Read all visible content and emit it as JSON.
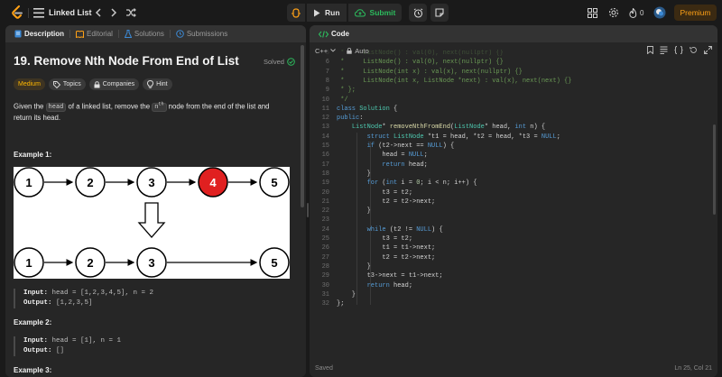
{
  "topbar": {
    "list_title": "Linked List",
    "run_label": "Run",
    "submit_label": "Submit",
    "streak_count": "0",
    "premium_label": "Premium"
  },
  "left": {
    "tabs": [
      "Description",
      "Editorial",
      "Solutions",
      "Submissions"
    ],
    "title": "19. Remove Nth Node From End of List",
    "solved_label": "Solved",
    "tags": [
      "Medium",
      "Topics",
      "Companies",
      "Hint"
    ],
    "desc_1": "Given the ",
    "desc_code_head": "head",
    "desc_2": " of a linked list, remove the ",
    "desc_code_nth": "n",
    "desc_sup": "th",
    "desc_3": " node from the end of the list and return its head.",
    "example1": "Example 1:",
    "example2": "Example 2:",
    "example3": "Example 3:",
    "ex1_input_label": "Input:",
    "ex1_input": " head = [1,2,3,4,5], n = 2",
    "ex1_output_label": "Output:",
    "ex1_output": " [1,2,3,5]",
    "ex2_input_label": "Input:",
    "ex2_input": " head = [1], n = 1",
    "ex2_output_label": "Output:",
    "ex2_output": " []",
    "diagram_top": [
      "1",
      "2",
      "3",
      "4",
      "5"
    ],
    "diagram_bottom": [
      "1",
      "2",
      "3",
      "5"
    ]
  },
  "right": {
    "tab": "Code",
    "language": "C++",
    "auto_label": "Auto",
    "status_saved": "Saved",
    "cursor_pos": "Ln 25, Col 21",
    "code": [
      {
        "n": "5",
        "t": " *     ListNode() : val(0), next(nullptr) {}",
        "c": "cm"
      },
      {
        "n": "6",
        "t": " *     ListNode() : val(0), next(nullptr) {}",
        "c": "cm"
      },
      {
        "n": "7",
        "t": " *     ListNode(int x) : val(x), next(nullptr) {}",
        "c": "cm"
      },
      {
        "n": "8",
        "t": " *     ListNode(int x, ListNode *next) : val(x), next(next) {}",
        "c": "cm"
      },
      {
        "n": "9",
        "t": " * };",
        "c": "cm"
      },
      {
        "n": "10",
        "t": " */",
        "c": "cm"
      },
      {
        "n": "11",
        "t": "class Solution {",
        "c": ""
      },
      {
        "n": "12",
        "t": "public:",
        "c": ""
      },
      {
        "n": "13",
        "t": "    ListNode* removeNthFromEnd(ListNode* head, int n) {",
        "c": ""
      },
      {
        "n": "14",
        "t": "        struct ListNode *t1 = head, *t2 = head, *t3 = NULL;",
        "c": ""
      },
      {
        "n": "15",
        "t": "        if (t2->next == NULL) {",
        "c": ""
      },
      {
        "n": "16",
        "t": "            head = NULL;",
        "c": ""
      },
      {
        "n": "17",
        "t": "            return head;",
        "c": ""
      },
      {
        "n": "18",
        "t": "        }",
        "c": ""
      },
      {
        "n": "19",
        "t": "        for (int i = 0; i < n; i++) {",
        "c": ""
      },
      {
        "n": "20",
        "t": "            t3 = t2;",
        "c": ""
      },
      {
        "n": "21",
        "t": "            t2 = t2->next;",
        "c": ""
      },
      {
        "n": "22",
        "t": "        }",
        "c": ""
      },
      {
        "n": "23",
        "t": "",
        "c": ""
      },
      {
        "n": "24",
        "t": "        while (t2 != NULL) {",
        "c": ""
      },
      {
        "n": "25",
        "t": "            t3 = t2;",
        "c": ""
      },
      {
        "n": "26",
        "t": "            t1 = t1->next;",
        "c": ""
      },
      {
        "n": "27",
        "t": "            t2 = t2->next;",
        "c": ""
      },
      {
        "n": "28",
        "t": "        }",
        "c": ""
      },
      {
        "n": "29",
        "t": "        t3->next = t1->next;",
        "c": ""
      },
      {
        "n": "30",
        "t": "        return head;",
        "c": ""
      },
      {
        "n": "31",
        "t": "    }",
        "c": ""
      },
      {
        "n": "32",
        "t": "};",
        "c": ""
      }
    ]
  },
  "colors": {
    "accent_orange": "#ffa116",
    "submit_green": "#2cbb5d",
    "medium_yellow": "#ffb800",
    "highlight_node": "#e02020"
  }
}
